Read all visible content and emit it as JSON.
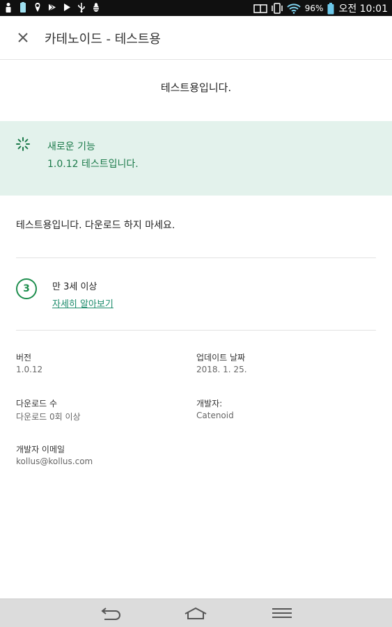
{
  "status_bar": {
    "battery_percent": "96%",
    "time": "오전 10:01",
    "icons": [
      "person-icon",
      "battery-small-icon",
      "maps-icon",
      "play-store-icon",
      "play-icon",
      "usb-icon",
      "bug-icon",
      "dual-window-icon",
      "vibrate-icon",
      "wifi-icon",
      "battery-icon"
    ]
  },
  "app_bar": {
    "title": "카테노이드 - 테스트용",
    "close_icon": "close-icon"
  },
  "subtitle": "테스트용입니다.",
  "whats_new": {
    "title": "새로운 기능",
    "body": "1.0.12 테스트입니다.",
    "icon": "loader-icon"
  },
  "description": "테스트용입니다. 다운로드 하지 마세요.",
  "content_rating": {
    "badge": "3",
    "label": "만 3세 이상",
    "link": "자세히 알아보기"
  },
  "info": {
    "version_label": "버전",
    "version_value": "1.0.12",
    "updated_label": "업데이트 날짜",
    "updated_value": "2018. 1. 25.",
    "downloads_label": "다운로드 수",
    "downloads_value": "다운로드 0회 이상",
    "developer_label": "개발자:",
    "developer_value": "Catenoid",
    "email_label": "개발자 이메일",
    "email_value": "kollus@kollus.com"
  },
  "colors": {
    "accent_green": "#1b7a4a",
    "banner_bg": "#e3f2ec",
    "link": "#1a8a6a"
  }
}
